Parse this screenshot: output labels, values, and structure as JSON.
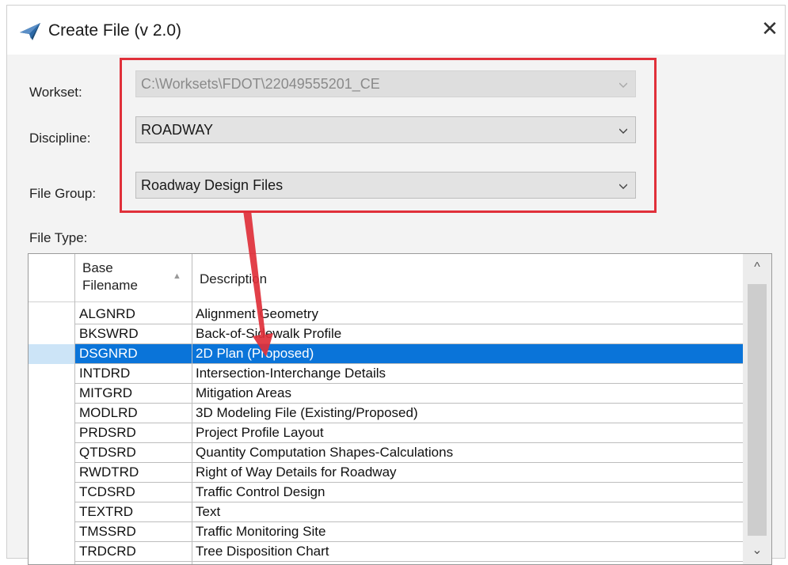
{
  "window": {
    "title": "Create File (v 2.0)",
    "close_glyph": "✕",
    "app_icon": "paper-plane-icon"
  },
  "form": {
    "workset_label": "Workset:",
    "workset_value": "C:\\Worksets\\FDOT\\22049555201_CE",
    "discipline_label": "Discipline:",
    "discipline_value": "ROADWAY",
    "file_group_label": "File Group:",
    "file_group_value": "Roadway Design Files",
    "file_type_label": "File Type:"
  },
  "table": {
    "col1_header_line1": "Base",
    "col1_header_line2": "Filename",
    "col2_header": "Description",
    "sort_glyph": "▲",
    "rows": [
      {
        "base": "ALGNRD",
        "desc": "Alignment Geometry",
        "selected": false
      },
      {
        "base": "BKSWRD",
        "desc": "Back-of-Sidewalk Profile",
        "selected": false
      },
      {
        "base": "DSGNRD",
        "desc": "2D Plan (Proposed)",
        "selected": true
      },
      {
        "base": "INTDRD",
        "desc": "Intersection-Interchange Details",
        "selected": false
      },
      {
        "base": "MITGRD",
        "desc": "Mitigation Areas",
        "selected": false
      },
      {
        "base": "MODLRD",
        "desc": "3D Modeling File (Existing/Proposed)",
        "selected": false
      },
      {
        "base": "PRDSRD",
        "desc": "Project Profile Layout",
        "selected": false
      },
      {
        "base": "QTDSRD",
        "desc": "Quantity Computation Shapes-Calculations",
        "selected": false
      },
      {
        "base": "RWDTRD",
        "desc": "Right of Way Details for Roadway",
        "selected": false
      },
      {
        "base": "TCDSRD",
        "desc": "Traffic Control Design",
        "selected": false
      },
      {
        "base": "TEXTRD",
        "desc": "Text",
        "selected": false
      },
      {
        "base": "TMSSRD",
        "desc": "Traffic Monitoring Site",
        "selected": false
      },
      {
        "base": "TRDCRD",
        "desc": "Tree Disposition Chart",
        "selected": false
      }
    ]
  },
  "scrollbar": {
    "up_glyph": "^",
    "down_glyph": "⌄"
  },
  "annotation": {
    "color": "#e0303a"
  },
  "colors": {
    "selection": "#0a74d9",
    "row_header_selection": "#cce4f7"
  }
}
